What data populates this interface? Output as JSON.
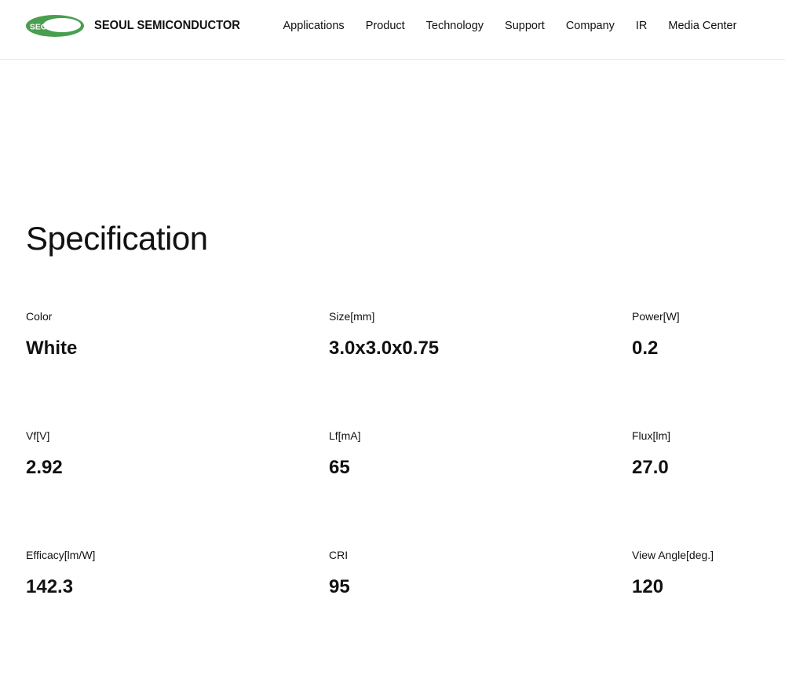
{
  "header": {
    "logo_badge": "SEOUL",
    "logo_text": "SEOUL SEMICONDUCTOR",
    "brand_color": "#4a9e4f",
    "nav": [
      {
        "label": "Applications"
      },
      {
        "label": "Product"
      },
      {
        "label": "Technology"
      },
      {
        "label": "Support"
      },
      {
        "label": "Company"
      },
      {
        "label": "IR"
      },
      {
        "label": "Media Center"
      }
    ]
  },
  "main": {
    "title": "Specification",
    "specs": [
      {
        "label": "Color",
        "value": "White"
      },
      {
        "label": "Size[mm]",
        "value": "3.0x3.0x0.75"
      },
      {
        "label": "Power[W]",
        "value": "0.2"
      },
      {
        "label": "Vf[V]",
        "value": "2.92"
      },
      {
        "label": "Lf[mA]",
        "value": "65"
      },
      {
        "label": "Flux[lm]",
        "value": "27.0"
      },
      {
        "label": "Efficacy[lm/W]",
        "value": "142.3"
      },
      {
        "label": "CRI",
        "value": "95"
      },
      {
        "label": "View Angle[deg.]",
        "value": "120"
      }
    ]
  }
}
